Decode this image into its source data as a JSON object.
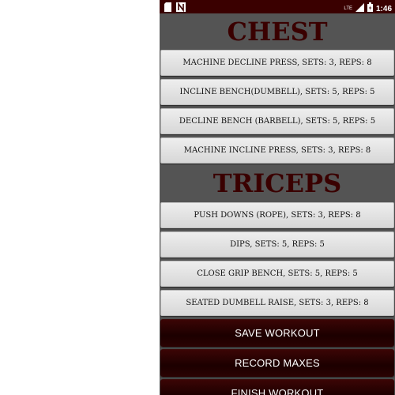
{
  "status_bar": {
    "time": "1:46",
    "network_label": "LTE",
    "icons": [
      "sim-card-icon",
      "n-app-icon",
      "signal-icon",
      "battery-icon"
    ]
  },
  "sections": [
    {
      "title": "CHEST",
      "exercises": [
        "MACHINE DECLINE PRESS, SETS: 3, REPS: 8",
        "INCLINE BENCH(DUMBELL), SETS: 5, REPS: 5",
        "DECLINE BENCH (BARBELL), SETS: 5, REPS: 5",
        "MACHINE INCLINE PRESS, SETS: 3, REPS: 8"
      ]
    },
    {
      "title": "TRICEPS",
      "exercises": [
        "PUSH DOWNS (ROPE), SETS: 3, REPS: 8",
        "DIPS, SETS: 5, REPS: 5",
        "CLOSE GRIP BENCH, SETS: 5, REPS: 5",
        "SEATED DUMBELL RAISE, SETS: 3, REPS: 8"
      ]
    }
  ],
  "actions": {
    "save_label": "SAVE WORKOUT",
    "record_label": "RECORD MAXES",
    "finish_label": "FINISH WORKOUT"
  },
  "colors": {
    "status_bar": "#3a0000",
    "background": "#545454",
    "title": "#3a0000",
    "action_button": "#1c0000"
  }
}
